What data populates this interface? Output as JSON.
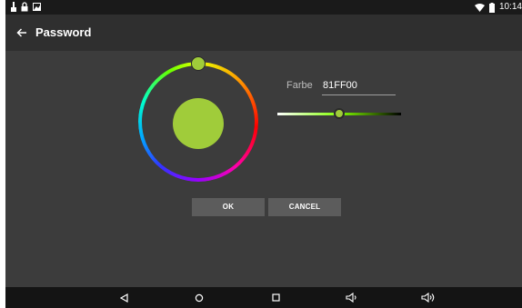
{
  "status_bar": {
    "time": "10:14",
    "left_icons": [
      "usb-icon",
      "lock-icon",
      "image-icon"
    ],
    "right_icons": [
      "wifi-icon",
      "battery-icon"
    ]
  },
  "app_bar": {
    "title": "Password",
    "back_icon": "arrow-left-icon"
  },
  "color_picker": {
    "label": "Farbe",
    "hex_value": "81FF00",
    "preview_color": "#a0cc3a",
    "selected_color": "#81ff00",
    "brightness_level": 0.5
  },
  "buttons": {
    "ok": "OK",
    "cancel": "CANCEL"
  },
  "nav_bar": {
    "icons": [
      "back-triangle-icon",
      "home-circle-icon",
      "recents-square-icon",
      "volume-down-icon",
      "volume-up-icon"
    ]
  },
  "colors": {
    "background": "#3c3c3c",
    "app_bar": "#2f2f2f",
    "status_bar": "#1a1a1a",
    "nav_bar": "#141414",
    "button": "#5c5c5c"
  }
}
